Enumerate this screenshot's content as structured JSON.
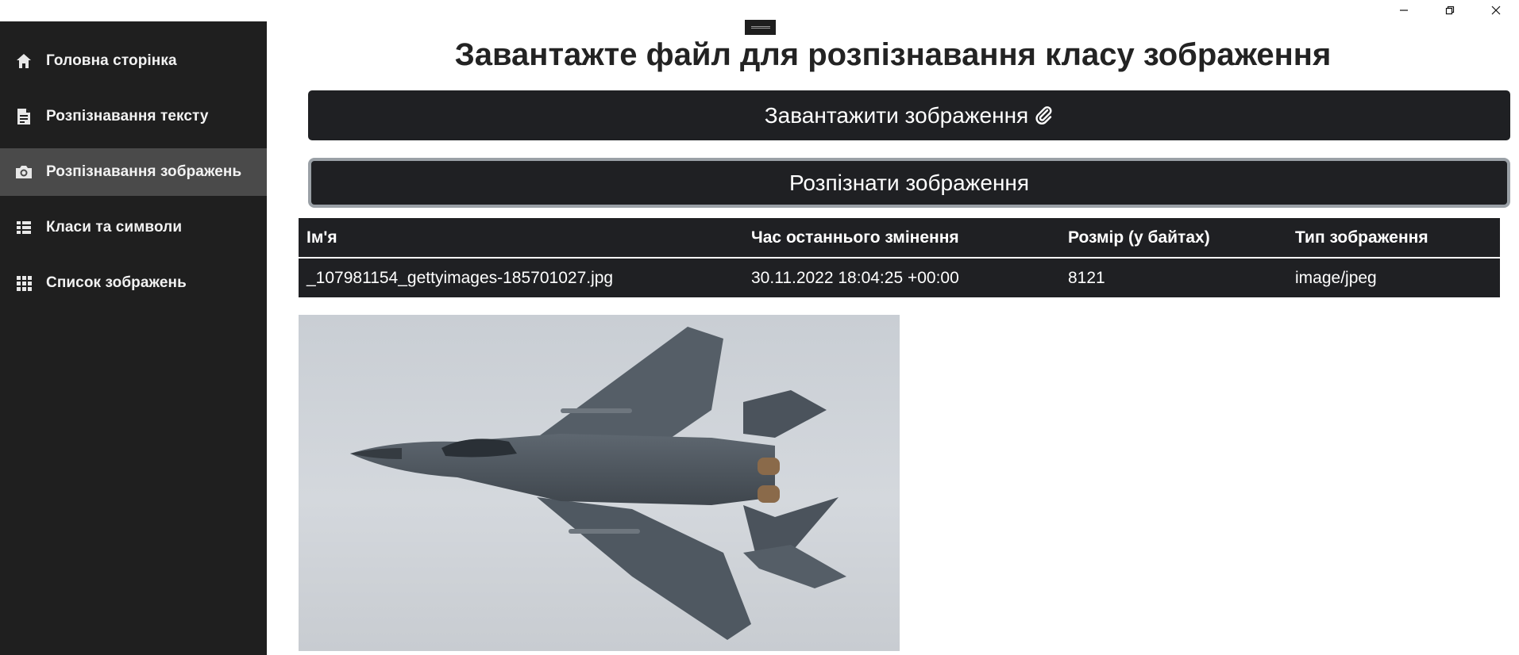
{
  "window": {
    "controls": [
      "minimize",
      "restore",
      "close"
    ]
  },
  "sidebar": {
    "items": [
      {
        "label": "Головна сторінка",
        "icon": "home-icon",
        "active": false
      },
      {
        "label": "Розпізнавання тексту",
        "icon": "document-icon",
        "active": false
      },
      {
        "label": "Розпізнавання зображень",
        "icon": "camera-icon",
        "active": true
      },
      {
        "label": "Класи та символи",
        "icon": "list-icon",
        "active": false
      },
      {
        "label": "Список зображень",
        "icon": "grid-icon",
        "active": false
      }
    ]
  },
  "main": {
    "title": "Завантажте файл для розпізнавання класу зображення",
    "upload_button": "Завантажити зображення",
    "recognize_button": "Розпізнати зображення",
    "table": {
      "headers": [
        "Ім'я",
        "Час останнього змінення",
        "Розмір (у байтах)",
        "Тип зображення"
      ],
      "rows": [
        [
          "_107981154_gettyimages-185701027.jpg",
          "30.11.2022 18:04:25 +00:00",
          "8121",
          "image/jpeg"
        ]
      ]
    },
    "preview": {
      "subject": "fighter jet photo"
    }
  },
  "colors": {
    "sidebar_bg": "#1f1f1f",
    "sidebar_active": "#4a4a4a",
    "button_bg": "#1f2023",
    "text_dark": "#232323"
  }
}
